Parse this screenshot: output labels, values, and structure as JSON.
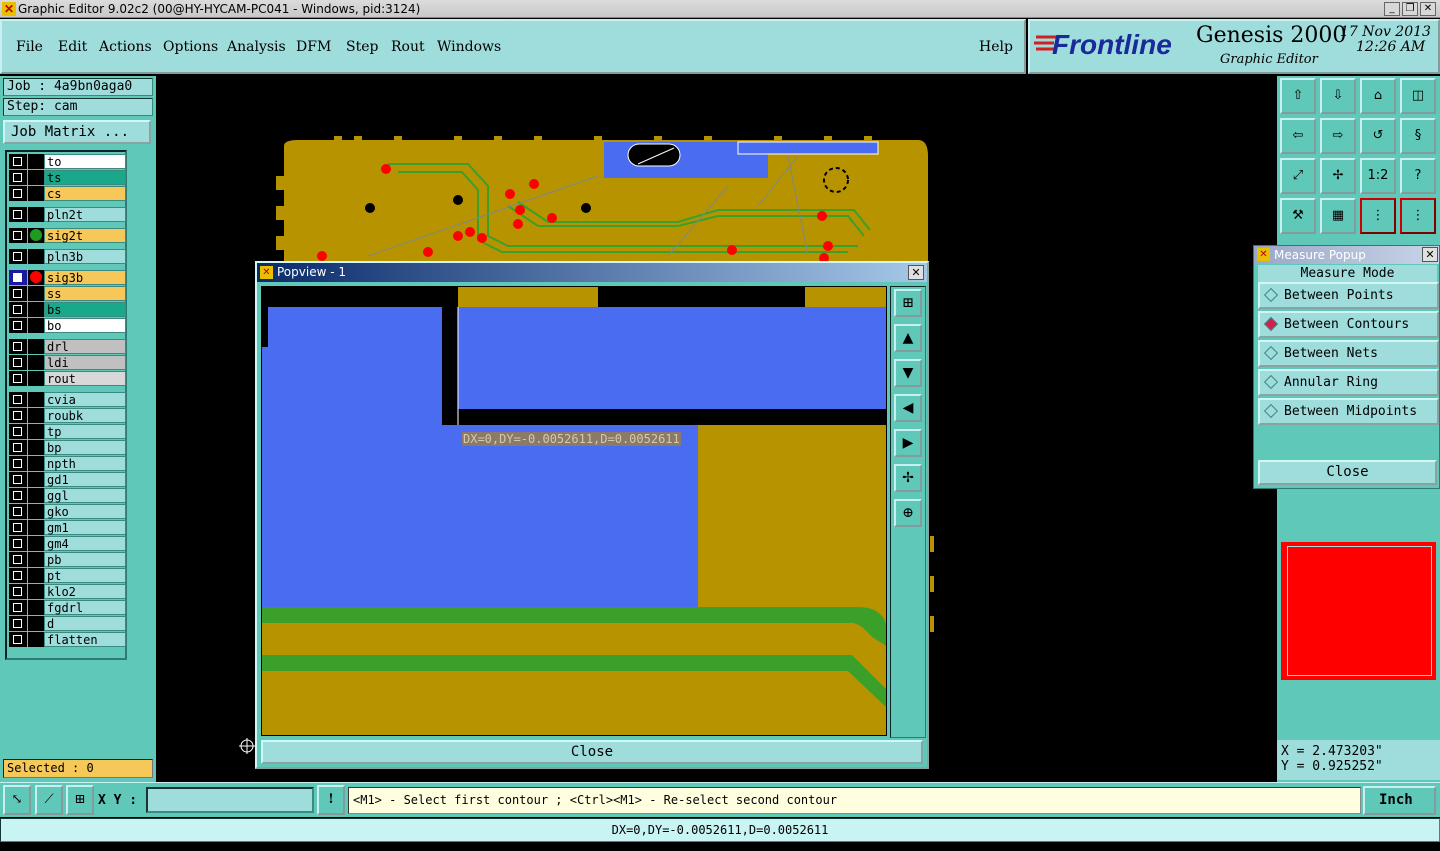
{
  "window": {
    "title": "Graphic Editor 9.02c2 (00@HY-HYCAM-PC041 - Windows, pid:3124)"
  },
  "menu": {
    "items": [
      "File",
      "Edit",
      "Actions",
      "Options",
      "Analysis",
      "DFM",
      "Step",
      "Rout",
      "Windows"
    ],
    "help": "Help"
  },
  "brand": {
    "logo": "Frontline",
    "product": "Genesis 2000",
    "subtitle": "Graphic Editor",
    "date": "17 Nov 2013",
    "time": "12:26 AM"
  },
  "job": {
    "job_line": "Job : 4a9bn0aga0",
    "step_line": "Step: cam",
    "matrix_button": "Job Matrix ..."
  },
  "layers": [
    {
      "name": "to",
      "color": "#ffffff"
    },
    {
      "name": "ts",
      "color": "#1aa88a"
    },
    {
      "name": "cs",
      "color": "#f6c859"
    },
    {
      "name": "pln2t",
      "color": "#9fdcdc"
    },
    {
      "name": "sig2t",
      "color": "#f6c859",
      "dot": "#1f9b1f"
    },
    {
      "name": "pln3b",
      "color": "#9fdcdc"
    },
    {
      "name": "sig3b",
      "color": "#f6c859",
      "dot": "#ff0000",
      "active": true
    },
    {
      "name": "ss",
      "color": "#f6c859"
    },
    {
      "name": "bs",
      "color": "#1aa88a"
    },
    {
      "name": "bo",
      "color": "#ffffff"
    },
    {
      "name": "drl",
      "color": "#c0c0c0"
    },
    {
      "name": "ldi",
      "color": "#c0c0c0"
    },
    {
      "name": "rout",
      "color": "#d8d8d8"
    },
    {
      "name": "cvia",
      "color": "#9fdcdc"
    },
    {
      "name": "roubk",
      "color": "#9fdcdc"
    },
    {
      "name": "tp",
      "color": "#9fdcdc"
    },
    {
      "name": "bp",
      "color": "#9fdcdc"
    },
    {
      "name": "npth",
      "color": "#9fdcdc"
    },
    {
      "name": "gd1",
      "color": "#9fdcdc"
    },
    {
      "name": "ggl",
      "color": "#9fdcdc"
    },
    {
      "name": "gko",
      "color": "#9fdcdc"
    },
    {
      "name": "gm1",
      "color": "#9fdcdc"
    },
    {
      "name": "gm4",
      "color": "#9fdcdc"
    },
    {
      "name": "pb",
      "color": "#9fdcdc"
    },
    {
      "name": "pt",
      "color": "#9fdcdc"
    },
    {
      "name": "klo2",
      "color": "#9fdcdc"
    },
    {
      "name": "fgdrl",
      "color": "#9fdcdc"
    },
    {
      "name": "d",
      "color": "#9fdcdc"
    },
    {
      "name": "flatten",
      "color": "#9fdcdc"
    }
  ],
  "selected": "Selected : 0",
  "popview": {
    "title": "Popview - 1",
    "measure_text": "DX=0,DY=-0.0052611,D=0.0052611",
    "close": "Close"
  },
  "measure_popup": {
    "title": "Measure Popup",
    "mode_label": "Measure Mode",
    "options": [
      "Between Points",
      "Between Contours",
      "Between Nets",
      "Annular Ring",
      "Between Midpoints"
    ],
    "selected_option": "Between Contours",
    "close": "Close"
  },
  "toolbar_labels": {
    "ratio": "1:2",
    "help": "?"
  },
  "coords": {
    "x": "X = 2.473203\"",
    "y": "Y = 0.925252\""
  },
  "bottom": {
    "xy_label": "X Y :",
    "xy_value": "",
    "exclaim": "!",
    "prompt": "<M1> - Select first contour ; <Ctrl><M1> - Re-select second contour",
    "unit": "Inch"
  },
  "status": "DX=0,DY=-0.0052611,D=0.0052611",
  "colors": {
    "panel": "#5fc8b8",
    "field": "#9fdcdc",
    "copper": "#b89300",
    "plane": "#4a6cf0",
    "trace": "#3aa02a",
    "pad": "#ff0000"
  }
}
